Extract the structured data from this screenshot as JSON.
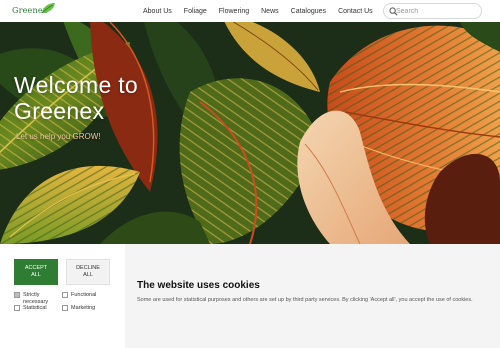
{
  "header": {
    "logo_text": "Greenex",
    "nav": [
      "About Us",
      "Foliage",
      "Flowering",
      "News",
      "Catalogues",
      "Contact Us"
    ],
    "search_placeholder": "Search"
  },
  "hero": {
    "title_line1": "Welcome to",
    "title_line2": "Greenex",
    "subtitle": "Let us help you GROW!"
  },
  "cookie": {
    "accept_line1": "ACCEPT",
    "accept_line2": "ALL",
    "decline_line1": "DECLINE",
    "decline_line2": "ALL",
    "options": {
      "strict_line1": "Strictly",
      "strict_line2": "necessary",
      "functional": "Functional",
      "statistical": "Statistical",
      "marketing": "Marketing"
    },
    "title": "The website uses cookies",
    "text": "Some are used for statistical purposes and others are set up by third party services. By clicking 'Accept all', you accept the use of cookies."
  },
  "colors": {
    "brand_green": "#2e7d32",
    "cookie_bg": "#f4f4f4"
  }
}
